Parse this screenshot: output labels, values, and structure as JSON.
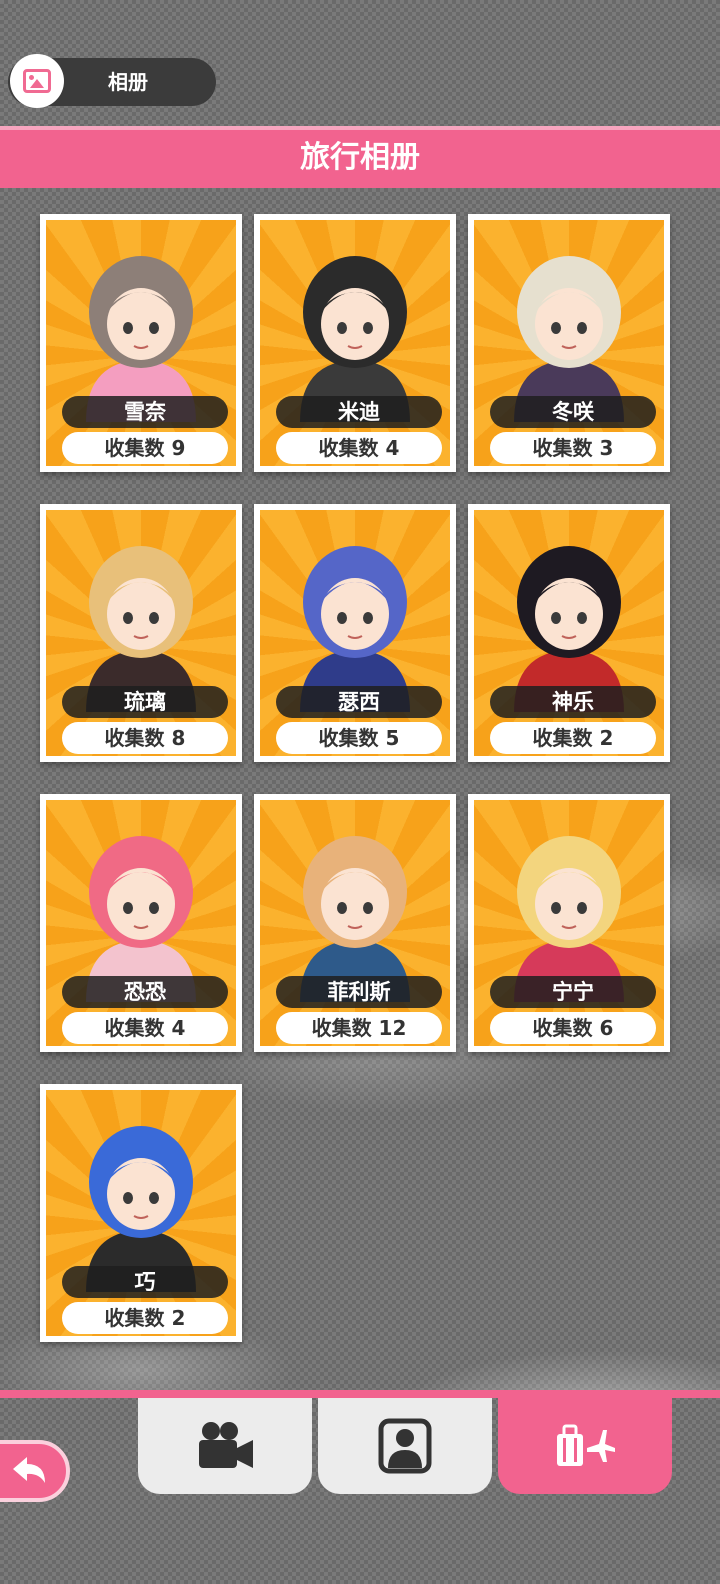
{
  "header": {
    "album_label": "相册",
    "album_icon": "photo-album-icon"
  },
  "banner": {
    "title": "旅行相册"
  },
  "count_prefix": "收集数",
  "cards": [
    {
      "name": "雪奈",
      "count": "收集数 9",
      "hair": "#8d7f78",
      "outfit": "#f49ec0"
    },
    {
      "name": "米迪",
      "count": "收集数 4",
      "hair": "#2b2b2b",
      "outfit": "#3a3a3a"
    },
    {
      "name": "冬咲",
      "count": "收集数 3",
      "hair": "#e6e0cf",
      "outfit": "#4a3a5a"
    },
    {
      "name": "琉璃",
      "count": "收集数 8",
      "hair": "#e8c07a",
      "outfit": "#3b2b2b"
    },
    {
      "name": "瑟西",
      "count": "收集数 5",
      "hair": "#5566c8",
      "outfit": "#2f3c8a"
    },
    {
      "name": "神乐",
      "count": "收集数 2",
      "hair": "#1e1a22",
      "outfit": "#c22a2a"
    },
    {
      "name": "恐恐",
      "count": "收集数 4",
      "hair": "#f06a85",
      "outfit": "#f3c3ce"
    },
    {
      "name": "菲利斯",
      "count": "收集数 12",
      "hair": "#e8b27a",
      "outfit": "#2e5a8a"
    },
    {
      "name": "宁宁",
      "count": "收集数 6",
      "hair": "#f3d57e",
      "outfit": "#d63a5a"
    },
    {
      "name": "巧",
      "count": "收集数 2",
      "hair": "#3a6ad8",
      "outfit": "#2b2b2b"
    }
  ],
  "tabs": [
    {
      "icon": "video-camera-icon",
      "active": false
    },
    {
      "icon": "character-portrait-icon",
      "active": false
    },
    {
      "icon": "travel-luggage-plane-icon",
      "active": true
    }
  ],
  "back_icon": "back-arrow-icon",
  "colors": {
    "accent": "#f2638f",
    "card_bg": "#f7a21a"
  }
}
